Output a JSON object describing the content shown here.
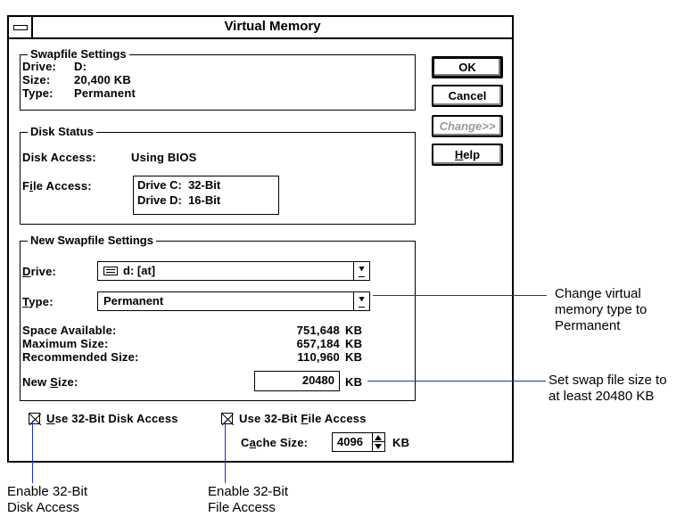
{
  "dialog": {
    "title": "Virtual Memory",
    "swapfile_settings": {
      "label": "Swapfile Settings",
      "drive_label": "Drive:",
      "drive_value": "D:",
      "size_label": "Size:",
      "size_value": "20,400 KB",
      "type_label": "Type:",
      "type_value": "Permanent"
    },
    "disk_status": {
      "label": "Disk Status",
      "disk_access_label": "Disk Access:",
      "disk_access_value": "Using BIOS",
      "file_access_label": "File Access:",
      "file_access_lines": [
        "Drive C:  32-Bit",
        "Drive D:  16-Bit"
      ]
    },
    "new_swapfile": {
      "label": "New Swapfile Settings",
      "drive_label": "Drive:",
      "drive_value": "d: [at]",
      "type_label": "Type:",
      "type_value": "Permanent",
      "space_available_label": "Space Available:",
      "space_available_value": "751,648",
      "maximum_size_label": "Maximum Size:",
      "maximum_size_value": "657,184",
      "recommended_size_label": "Recommended Size:",
      "recommended_size_value": "110,960",
      "unit": "KB",
      "new_size_label": "New Size:",
      "new_size_value": "20480"
    },
    "options": {
      "disk_access_label": "Use 32-Bit Disk Access",
      "file_access_label": "Use 32-Bit File Access",
      "disk_access_checked": true,
      "file_access_checked": true,
      "cache_size_label": "Cache Size:",
      "cache_size_value": "4096",
      "unit": "KB"
    },
    "buttons": {
      "ok": "OK",
      "cancel": "Cancel",
      "change": "Change>>",
      "help": "Help"
    }
  },
  "annotations": {
    "type": "Change virtual memory type to Permanent",
    "type_lines": [
      "Change virtual",
      "memory type to",
      "Permanent"
    ],
    "size_lines": [
      "Set swap file size to",
      "at least 20480 KB"
    ],
    "disk_lines": [
      "Enable 32-Bit",
      "Disk Access"
    ],
    "file_lines": [
      "Enable 32-Bit",
      "File Access"
    ]
  },
  "colors": {
    "callout_line": "#1a2fd0"
  },
  "icons": [
    "system-menu-icon",
    "drive-icon",
    "dropdown-arrow-icon",
    "spinner-icon",
    "checkbox-checked-icon"
  ]
}
